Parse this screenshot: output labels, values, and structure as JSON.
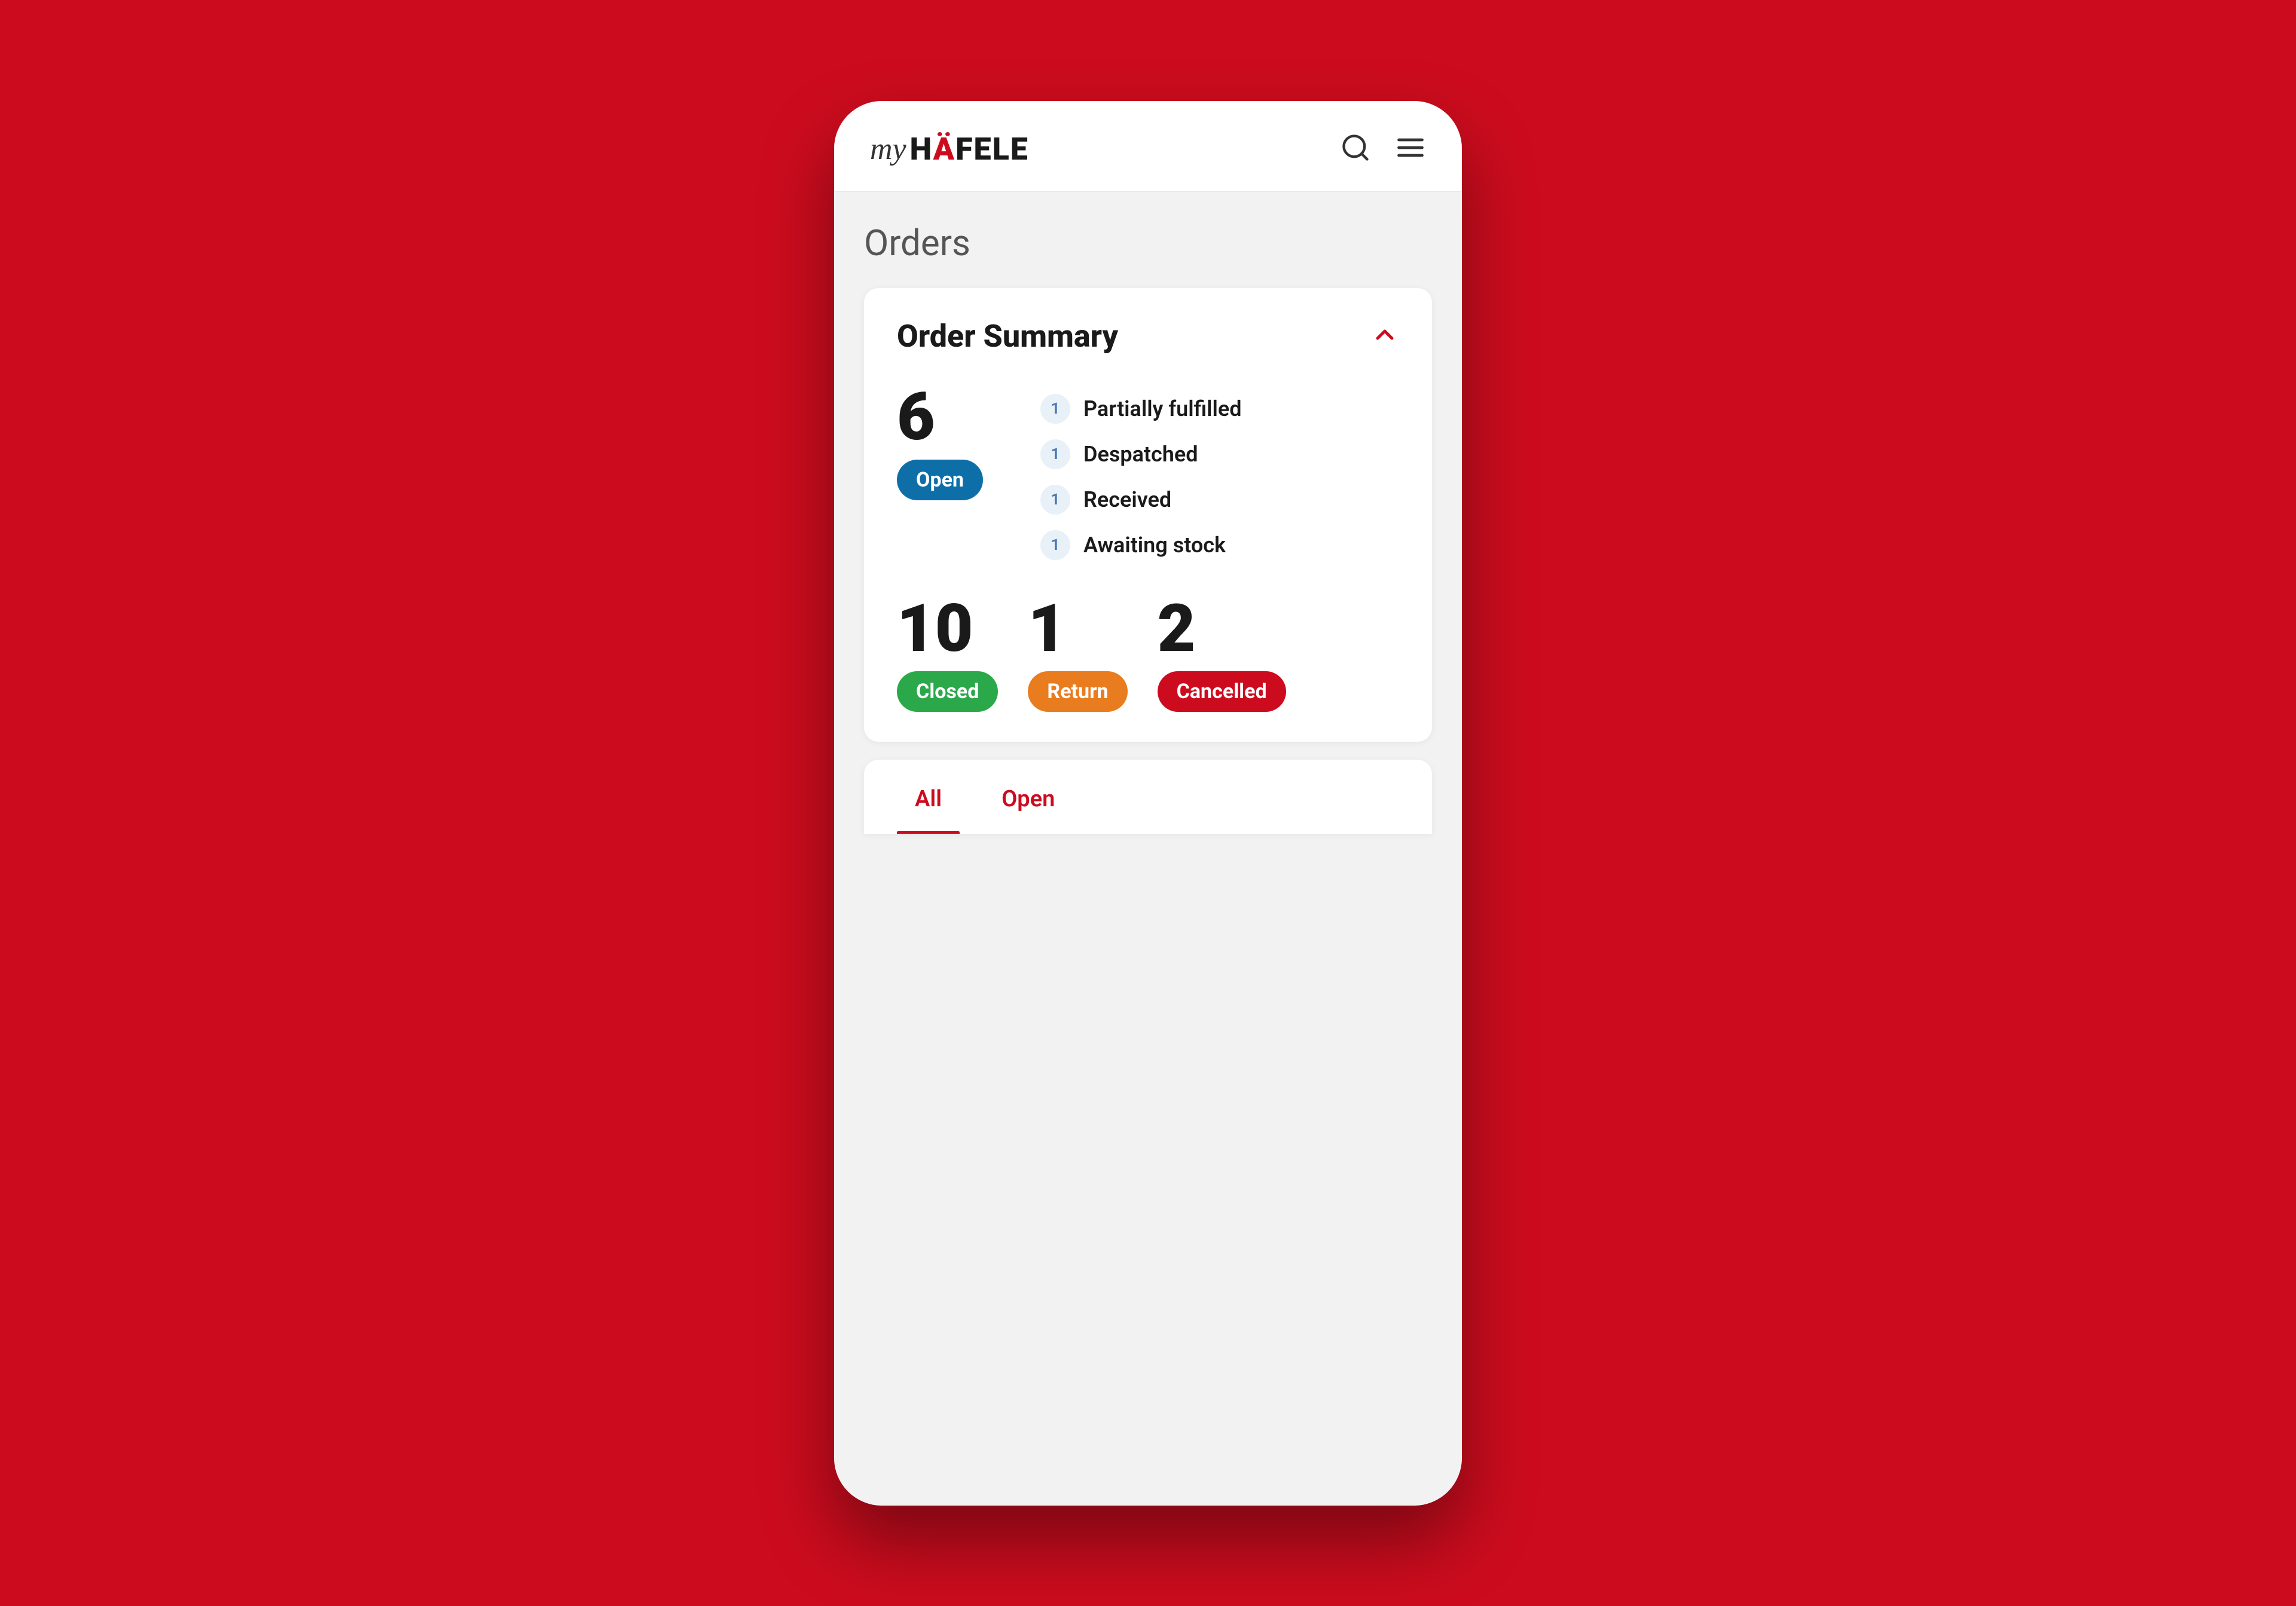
{
  "app": {
    "logo_my": "my",
    "logo_hafele": "HÄFELE"
  },
  "page": {
    "title": "Orders"
  },
  "order_summary": {
    "title": "Order Summary",
    "open_count": "6",
    "open_label": "Open",
    "statuses": [
      {
        "count": "1",
        "label": "Partially fulfilled"
      },
      {
        "count": "1",
        "label": "Despatched"
      },
      {
        "count": "1",
        "label": "Received"
      },
      {
        "count": "1",
        "label": "Awaiting stock"
      }
    ],
    "closed_count": "10",
    "closed_label": "Closed",
    "return_count": "1",
    "return_label": "Return",
    "cancelled_count": "2",
    "cancelled_label": "Cancelled"
  },
  "tabs": [
    {
      "label": "All",
      "active": true
    },
    {
      "label": "Open",
      "active": false
    }
  ],
  "colors": {
    "brand_red": "#cc0c1e",
    "open_blue": "#0e6fa8",
    "closed_green": "#2ba84a",
    "return_orange": "#e87c1e",
    "cancelled_red": "#cc0c1e"
  }
}
